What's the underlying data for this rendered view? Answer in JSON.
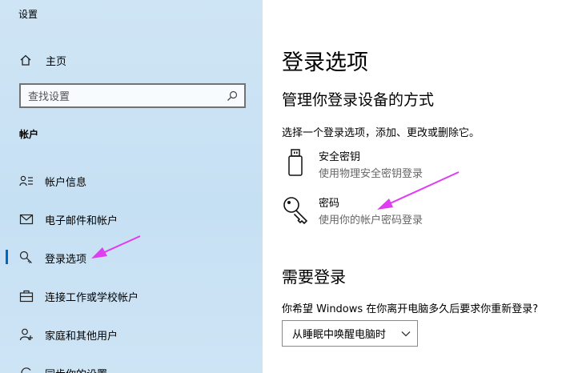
{
  "sidebar": {
    "app_title": "设置",
    "home_label": "主页",
    "search_placeholder": "查找设置",
    "section_label": "帐户",
    "items": [
      {
        "label": "帐户信息"
      },
      {
        "label": "电子邮件和帐户"
      },
      {
        "label": "登录选项"
      },
      {
        "label": "连接工作或学校帐户"
      },
      {
        "label": "家庭和其他用户"
      },
      {
        "label": "同步你的设置"
      }
    ],
    "selected_index": 2
  },
  "main": {
    "title": "登录选项",
    "subtitle": "管理你登录设备的方式",
    "description": "选择一个登录选项，添加、更改或删除它。",
    "options": [
      {
        "title": "安全密钥",
        "description": "使用物理安全密钥登录",
        "icon": "usb-key-icon"
      },
      {
        "title": "密码",
        "description": "使用你的帐户密码登录",
        "icon": "key-icon"
      }
    ],
    "require_signin": {
      "heading": "需要登录",
      "question": "你希望 Windows 在你离开电脑多久后要求你重新登录?",
      "dropdown_value": "从睡眠中唤醒电脑时"
    }
  },
  "colors": {
    "sidebar_bg": "#c6e0f3",
    "accent": "#0067c0",
    "annotation_arrow": "#e03cf2"
  }
}
